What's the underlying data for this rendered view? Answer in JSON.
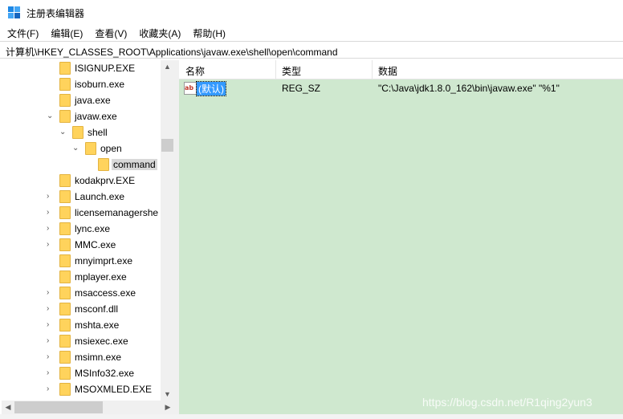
{
  "window": {
    "title": "注册表编辑器",
    "accent": "#3399ff"
  },
  "menu": [
    "文件(F)",
    "编辑(E)",
    "查看(V)",
    "收藏夹(A)",
    "帮助(H)"
  ],
  "address": {
    "path": "计算机\\HKEY_CLASSES_ROOT\\Applications\\javaw.exe\\shell\\open\\command"
  },
  "tree": {
    "items": [
      {
        "label": "ISIGNUP.EXE",
        "level": 0,
        "expander": "none"
      },
      {
        "label": "isoburn.exe",
        "level": 0,
        "expander": "none"
      },
      {
        "label": "java.exe",
        "level": 0,
        "expander": "none"
      },
      {
        "label": "javaw.exe",
        "level": 0,
        "expander": "expanded"
      },
      {
        "label": "shell",
        "level": 1,
        "expander": "expanded"
      },
      {
        "label": "open",
        "level": 2,
        "expander": "expanded"
      },
      {
        "label": "command",
        "level": 3,
        "expander": "none",
        "selected": true
      },
      {
        "label": "kodakprv.EXE",
        "level": 0,
        "expander": "none"
      },
      {
        "label": "Launch.exe",
        "level": 0,
        "expander": "collapsed"
      },
      {
        "label": "licensemanagershe",
        "level": 0,
        "expander": "collapsed"
      },
      {
        "label": "lync.exe",
        "level": 0,
        "expander": "collapsed"
      },
      {
        "label": "MMC.exe",
        "level": 0,
        "expander": "collapsed"
      },
      {
        "label": "mnyimprt.exe",
        "level": 0,
        "expander": "none"
      },
      {
        "label": "mplayer.exe",
        "level": 0,
        "expander": "none"
      },
      {
        "label": "msaccess.exe",
        "level": 0,
        "expander": "collapsed"
      },
      {
        "label": "msconf.dll",
        "level": 0,
        "expander": "collapsed"
      },
      {
        "label": "mshta.exe",
        "level": 0,
        "expander": "collapsed"
      },
      {
        "label": "msiexec.exe",
        "level": 0,
        "expander": "collapsed"
      },
      {
        "label": "msimn.exe",
        "level": 0,
        "expander": "collapsed"
      },
      {
        "label": "MSInfo32.exe",
        "level": 0,
        "expander": "collapsed"
      },
      {
        "label": "MSOXMLED.EXE",
        "level": 0,
        "expander": "collapsed"
      }
    ]
  },
  "list": {
    "columns": [
      "名称",
      "类型",
      "数据"
    ],
    "rows": [
      {
        "name": "(默认)",
        "type": "REG_SZ",
        "data": "\"C:\\Java\\jdk1.8.0_162\\bin\\javaw.exe\" \"%1\""
      }
    ],
    "background": "#cfe8cf"
  },
  "watermark": "https://blog.csdn.net/R1qing2yun3"
}
